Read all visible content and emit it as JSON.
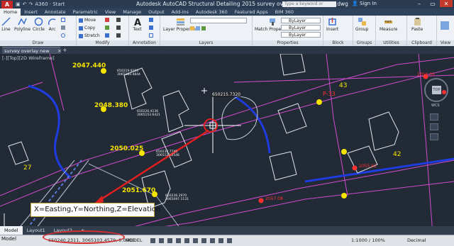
{
  "titlebar": {
    "app_logo": "A",
    "start_tab": "A360 · Start",
    "title": "Autodesk AutoCAD Structural Detailing 2015   survey overlay new boundary.dwg",
    "search_placeholder": "Type a keyword or phrase",
    "signin": "Sign In"
  },
  "tabs": [
    "Home",
    "Insert",
    "Annotate",
    "Parametric",
    "View",
    "Manage",
    "Output",
    "Add-ins",
    "Autodesk 360",
    "Featured Apps",
    "BIM 360"
  ],
  "active_tab": "Home",
  "ribbon": {
    "draw": {
      "title": "Draw",
      "tools": [
        "Line",
        "Polyline",
        "Circle",
        "Arc"
      ]
    },
    "modify": {
      "title": "Modify",
      "tools": [
        "Move",
        "Copy",
        "Stretch"
      ]
    },
    "annotation": {
      "title": "Annotation",
      "tools": [
        "Text"
      ]
    },
    "layers": {
      "title": "Layers",
      "tools": [
        "Layer Properties"
      ]
    },
    "properties": {
      "title": "Properties",
      "tools": [
        "Match Properties"
      ],
      "combos": [
        "ByLayer",
        "ByLayer",
        "ByLayer"
      ]
    },
    "block": {
      "title": "Block",
      "tools": [
        "Insert"
      ]
    },
    "groups": {
      "title": "Groups",
      "tools": [
        "Group"
      ]
    },
    "utilities": {
      "title": "Utilities",
      "tools": [
        "Measure"
      ]
    },
    "clipboard": {
      "title": "Clipboard",
      "tools": [
        "Paste"
      ]
    },
    "view": {
      "title": "View"
    }
  },
  "doc_tab": "survey overlay new boundary*",
  "viewport_label": "[-][Top][2D Wireframe]",
  "elevations": [
    "2047.440",
    "2048.380",
    "2050.025",
    "2051.670"
  ],
  "lot_numbers": [
    "43",
    "42",
    "27"
  ],
  "red_labels": {
    "p33": "P-33",
    "l1": "2050.05",
    "l2": "2055.92",
    "l3": "2057.08"
  },
  "small_coords": [
    "650219.9193\n3065183.4844",
    "650226.4136\n3065153.6421",
    "650234.7745\n3065120.2546",
    "650236.2970\n3065097.1131"
  ],
  "cursor_coord": "650215.7320",
  "callout_text": "X=Easting,Y=Northing,Z=Elevation",
  "layout_tabs": [
    "Model",
    "Layout1",
    "Layout2"
  ],
  "status": {
    "coords": "650240.2311, 3065103.4579, 0.0000",
    "model": "MODEL",
    "scale": "1:1000 / 100%",
    "units": "Decimal"
  },
  "viewcube": {
    "top": "TOP",
    "n": "N",
    "s": "S",
    "w": "W",
    "e": "E",
    "wcs": "WCS"
  },
  "colors": {
    "annotation_red": "#d32f2f",
    "elevation_yellow": "#f5e400",
    "road_magenta": "#d04bd0",
    "curb_blue": "#1e3ce0"
  }
}
